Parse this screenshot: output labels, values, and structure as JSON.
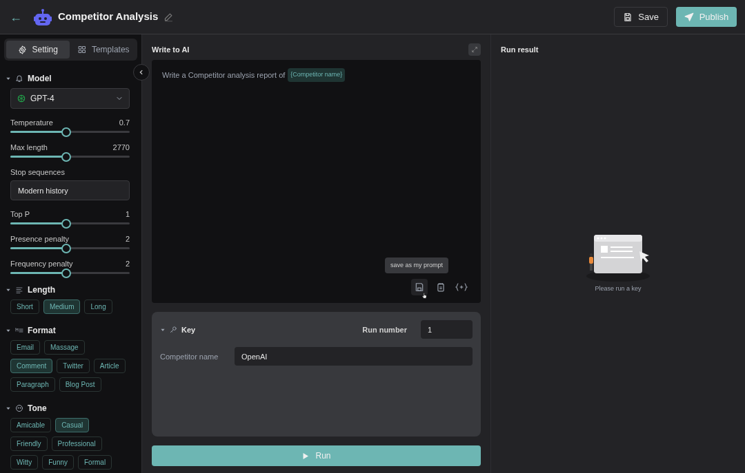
{
  "header": {
    "back": "←",
    "title": "Competitor Analysis",
    "save": "Save",
    "publish": "Publish"
  },
  "sidebar": {
    "tabs": [
      {
        "label": "Setting",
        "selected": true
      },
      {
        "label": "Templates",
        "selected": false
      }
    ],
    "model": {
      "title": "Model",
      "expanded": true,
      "dropdown": "GPT-4",
      "params": [
        {
          "kind": "slider",
          "label": "Temperature",
          "reading": "0.7",
          "level": 0.47
        },
        {
          "kind": "slider",
          "label": "Max length",
          "reading": "2770",
          "level": 0.47
        },
        {
          "kind": "field",
          "label": "Stop sequences",
          "value": "Modern history"
        },
        {
          "kind": "slider",
          "label": "Top P",
          "reading": "1",
          "level": 0.47
        },
        {
          "kind": "slider",
          "label": "Presence penalty",
          "reading": "2",
          "level": 0.47
        },
        {
          "kind": "slider",
          "label": "Frequency penalty",
          "reading": "2",
          "level": 0.47
        }
      ]
    },
    "sections": [
      {
        "title": "Length",
        "expanded": true,
        "chip_rows": [
          [
            {
              "label": "Short",
              "selected": false
            },
            {
              "label": "Medium",
              "selected": true
            },
            {
              "label": "Long",
              "selected": false
            }
          ]
        ]
      },
      {
        "title": "Format",
        "expanded": true,
        "chip_rows": [
          [
            {
              "label": "Email",
              "selected": false
            },
            {
              "label": "Massage",
              "selected": false
            }
          ],
          [
            {
              "label": "Comment",
              "selected": true
            },
            {
              "label": "Twitter",
              "selected": false
            },
            {
              "label": "Article",
              "selected": false
            }
          ],
          [
            {
              "label": "Paragraph",
              "selected": false
            },
            {
              "label": "Blog Post",
              "selected": false
            }
          ]
        ]
      },
      {
        "title": "Tone",
        "expanded": true,
        "chip_rows": [
          [
            {
              "label": "Amicable",
              "selected": false
            },
            {
              "label": "Casual",
              "selected": true
            }
          ],
          [
            {
              "label": "Friendly",
              "selected": false
            },
            {
              "label": "Professional",
              "selected": false
            }
          ],
          [
            {
              "label": "Witty",
              "selected": false
            },
            {
              "label": "Funny",
              "selected": false
            },
            {
              "label": "Formal",
              "selected": false
            }
          ]
        ]
      }
    ]
  },
  "editor": {
    "title": "Write to AI",
    "prompt": "Write a Competitor analysis report of",
    "variable": "{Competitor name}",
    "tooltip": "save as my prompt"
  },
  "key_panel": {
    "title": "Key",
    "expanded": true,
    "run_number_label": "Run number",
    "run_number": "1",
    "variables": [
      {
        "label": "Competitor name",
        "value": "OpenAI"
      }
    ]
  },
  "run_button": "Run",
  "result": {
    "title": "Run result",
    "empty_message": "Please run a key"
  }
}
